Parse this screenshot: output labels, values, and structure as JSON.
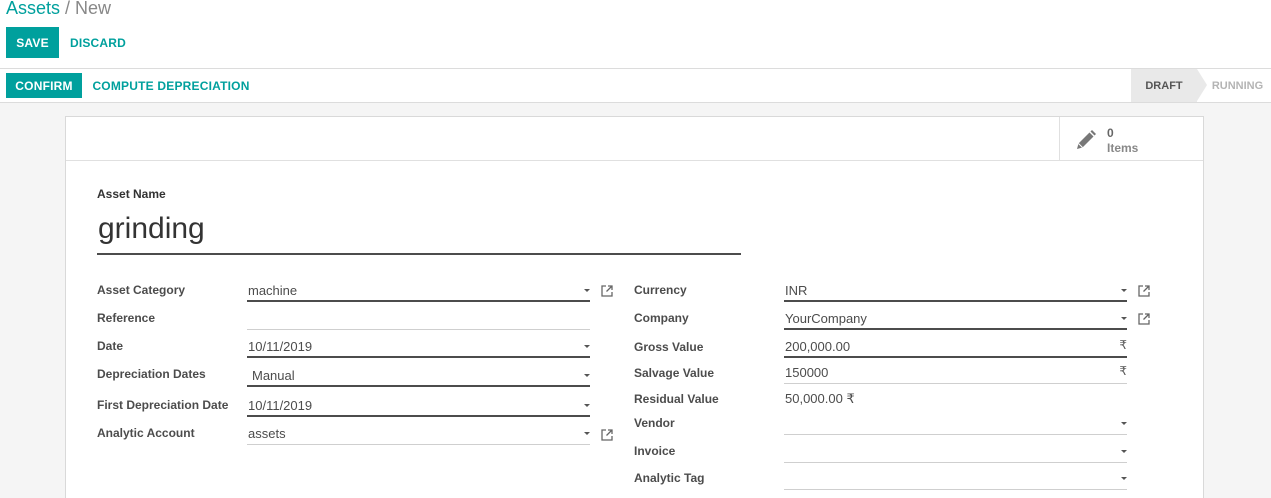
{
  "breadcrumb": {
    "parent": "Assets",
    "separator": "/",
    "current": "New"
  },
  "control_panel": {
    "save_label": "SAVE",
    "discard_label": "DISCARD"
  },
  "header_buttons": {
    "confirm_label": "CONFIRM",
    "compute_label": "COMPUTE DEPRECIATION"
  },
  "status_bar": {
    "stages": [
      "DRAFT",
      "RUNNING"
    ],
    "active": "DRAFT"
  },
  "stat_button": {
    "icon": "pencil-icon",
    "value": "0",
    "text": "Items"
  },
  "asset_name": {
    "label": "Asset Name",
    "value": "grinding"
  },
  "left_fields": {
    "category": {
      "label": "Asset Category",
      "value": "machine"
    },
    "reference": {
      "label": "Reference",
      "value": ""
    },
    "date": {
      "label": "Date",
      "value": "10/11/2019"
    },
    "depreciation_dates": {
      "label": "Depreciation Dates",
      "value": "Manual"
    },
    "first_depreciation_date": {
      "label": "First Depreciation Date",
      "value": "10/11/2019"
    },
    "analytic_account": {
      "label": "Analytic Account",
      "value": "assets"
    }
  },
  "right_fields": {
    "currency": {
      "label": "Currency",
      "value": "INR"
    },
    "company": {
      "label": "Company",
      "value": "YourCompany"
    },
    "gross_value": {
      "label": "Gross Value",
      "value": "200,000.00",
      "symbol": "₹"
    },
    "salvage_value": {
      "label": "Salvage Value",
      "value": "150000",
      "symbol": "₹"
    },
    "residual_value": {
      "label": "Residual Value",
      "value": "50,000.00 ₹"
    },
    "vendor": {
      "label": "Vendor",
      "value": ""
    },
    "invoice": {
      "label": "Invoice",
      "value": ""
    },
    "analytic_tag": {
      "label": "Analytic Tag",
      "value": ""
    }
  },
  "colors": {
    "accent": "#00a09d",
    "text": "#4c4c4c",
    "background": "#f5f5f5"
  }
}
